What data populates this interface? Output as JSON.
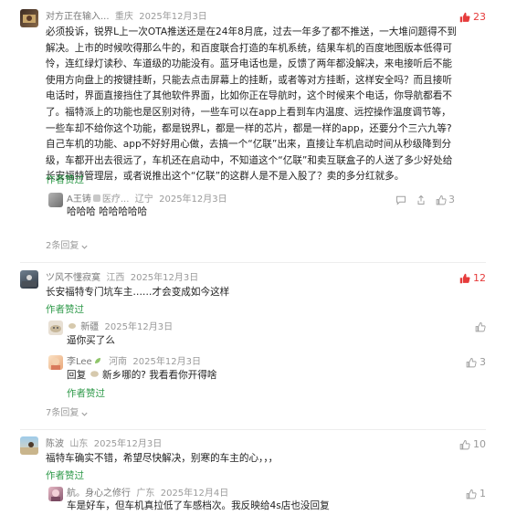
{
  "comments": [
    {
      "name": "对方正在输入...",
      "location": "重庆",
      "date": "2025年12月3日",
      "likes": "23",
      "lines": [
        "必须投诉，锐界L上一次OTA推送还是在24年8月底，过去一年多了都不推送，一大堆问题得不到",
        "解决。上市的时候吹得那么牛的，和百度联合打造的车机系统，结果车机的百度地图版本低得可",
        "怜，连红绿灯读秒、车道级的功能没有。蓝牙电话也是，反馈了两年都没解决，来电接听后不能",
        "使用方向盘上的按键挂断，只能去点击屏幕上的挂断，或者等对方挂断，这样安全吗？而且接听",
        "电话时，界面直接挡住了其他软件界面，比如你正在导航时，这个时候来个电话，你导航都看不",
        "了。福特派上的功能也是区别对待，一些车可以在app上看到车内温度、远控操作温度调节等，",
        "一些车却不给你这个功能，都是锐界L，都是一样的芯片，都是一样的app，还要分个三六九等?",
        "自己车机的功能、app不好好用心做，去搞一个“亿联”出来，直接让车机启动时间从秒级降到分",
        "级，车都开出去很远了，车机还在启动中，不知道这个“亿联”和卖互联盒子的人送了多少好处给",
        "长安福特管理层，或者说推出这个“亿联”的这群人是不是入股了？卖的多分红就多。"
      ],
      "author_liked": "作者赞过",
      "replies": [
        {
          "name": "A王铸",
          "name_suffix": "医疗...",
          "location": "辽宁",
          "date": "2025年12月3日",
          "likes": "3",
          "text": "哈哈哈 哈哈哈哈哈"
        }
      ],
      "more": "2条回复"
    },
    {
      "name": "ツ风不懂寂寞",
      "location": "江西",
      "date": "2025年12月3日",
      "likes": "12",
      "text": "长安福特专门坑车主……才会变成如今这样",
      "author_liked": "作者赞过",
      "replies": [
        {
          "name": "新疆",
          "location": "",
          "date": "2025年12月3日",
          "likes": "",
          "text": "逼你买了么"
        },
        {
          "name": "李Lee",
          "location": "河南",
          "date": "2025年12月3日",
          "likes": "3",
          "text_prefix": "回复",
          "reply_to": "新乡哪的? 我看看你开得啥",
          "author_liked": "作者赞过"
        }
      ],
      "more": "7条回复"
    },
    {
      "name": "陈波",
      "location": "山东",
      "date": "2025年12月3日",
      "likes": "10",
      "text": "福特车确实不错，希望尽快解决，别寒的车主的心，，，",
      "author_liked": "作者赞过",
      "replies": [
        {
          "name": "航。身心之修行",
          "location": "广东",
          "date": "2025年12月4日",
          "likes": "1",
          "text": "车是好车，但车机真拉低了车感档次。我反映给4s店也没回复"
        }
      ]
    }
  ],
  "colors": {
    "hot": "#e63b3b",
    "author": "#2f9a4a",
    "meta": "#9a9a9a"
  }
}
